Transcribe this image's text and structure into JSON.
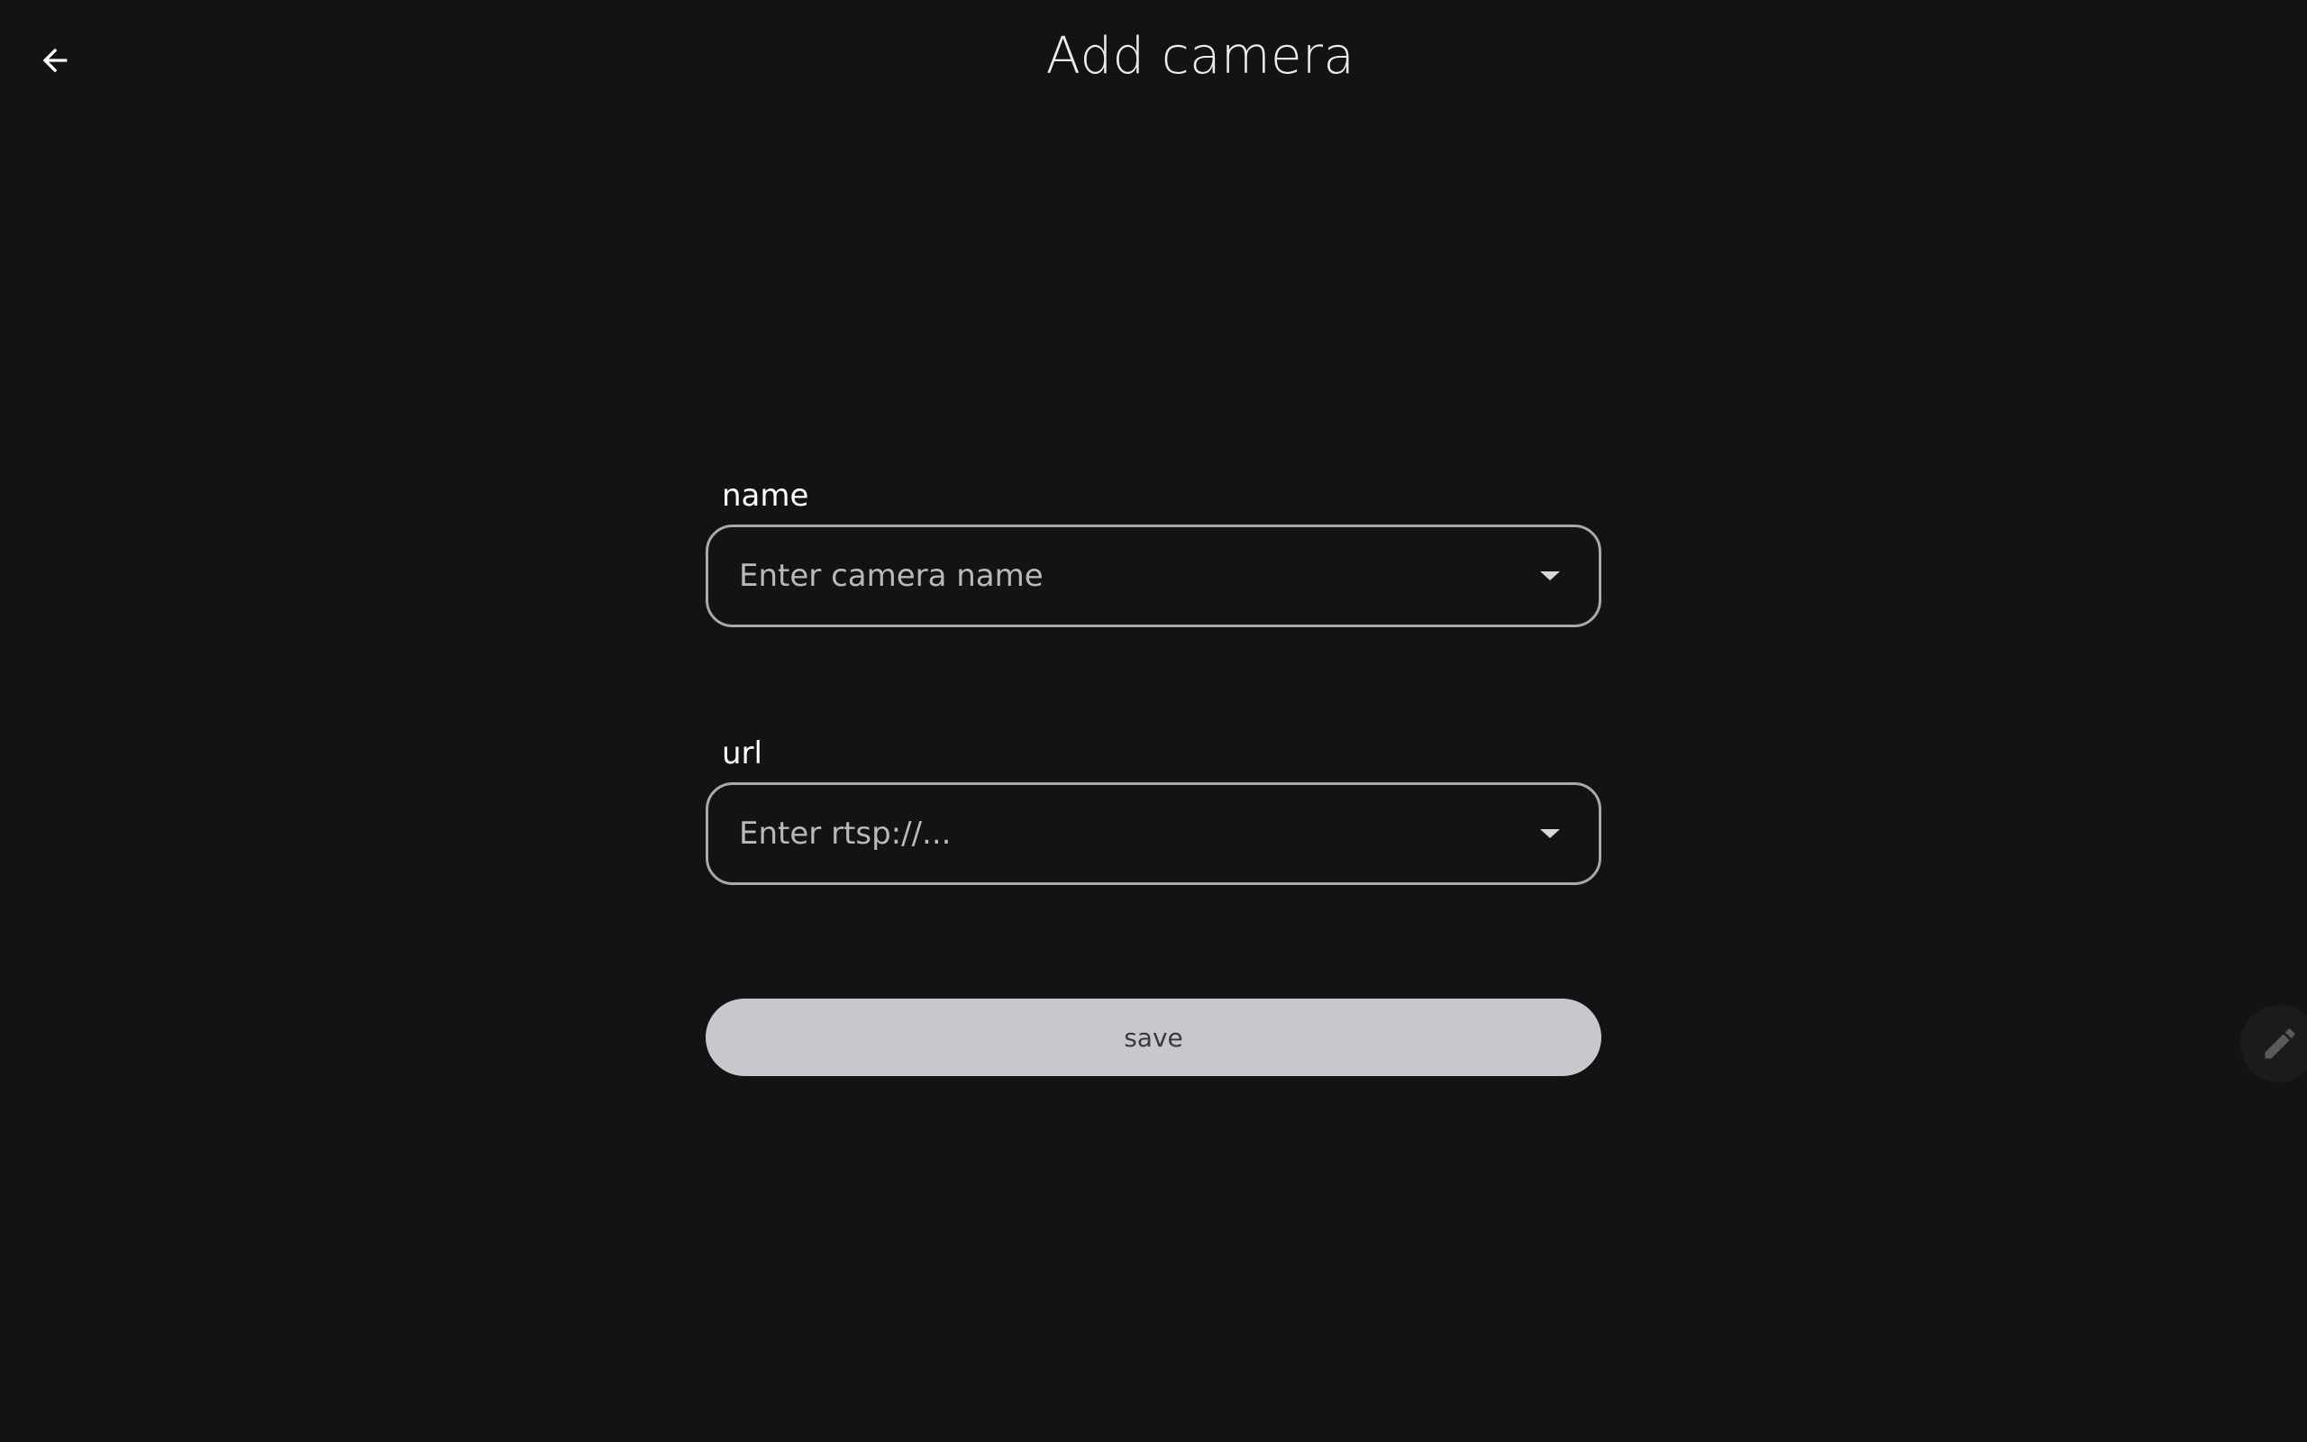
{
  "header": {
    "title": "Add camera",
    "back_icon": "arrow-left-icon"
  },
  "form": {
    "name": {
      "label": "name",
      "placeholder": "Enter camera name",
      "value": "",
      "dropdown_icon": "caret-down-icon"
    },
    "url": {
      "label": "url",
      "placeholder": "Enter rtsp://...",
      "value": "",
      "dropdown_icon": "caret-down-icon"
    },
    "save_label": "save"
  },
  "fab": {
    "icon": "pencil-icon"
  },
  "colors": {
    "background": "#131313",
    "text": "#ececec",
    "field_border": "#a9a9ad",
    "placeholder": "#b9b9bc",
    "button_bg": "#c7c7cd",
    "button_text": "#3a3a3d"
  }
}
